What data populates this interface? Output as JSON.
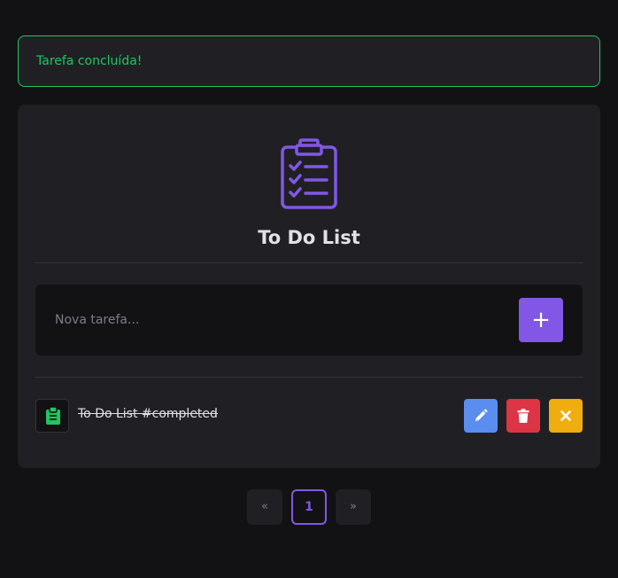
{
  "alert": {
    "message": "Tarefa concluída!",
    "color": "#22c55e"
  },
  "app": {
    "title": "To Do List",
    "logo_icon": "clipboard-checklist-icon",
    "accent_color": "#8257e5"
  },
  "form": {
    "placeholder": "Nova tarefa...",
    "add_label": "+"
  },
  "tasks": [
    {
      "icon": "clipboard-icon",
      "text": "To Do List #completed",
      "completed": true,
      "actions": [
        {
          "name": "edit-button",
          "icon": "pencil-icon",
          "color": "#5b8def"
        },
        {
          "name": "delete-button",
          "icon": "trash-icon",
          "color": "#dc3545"
        },
        {
          "name": "undo-button",
          "icon": "close-icon",
          "color": "#f0ad10"
        }
      ]
    }
  ],
  "pagination": {
    "prev_label": "«",
    "current_page": "1",
    "next_label": "»"
  }
}
